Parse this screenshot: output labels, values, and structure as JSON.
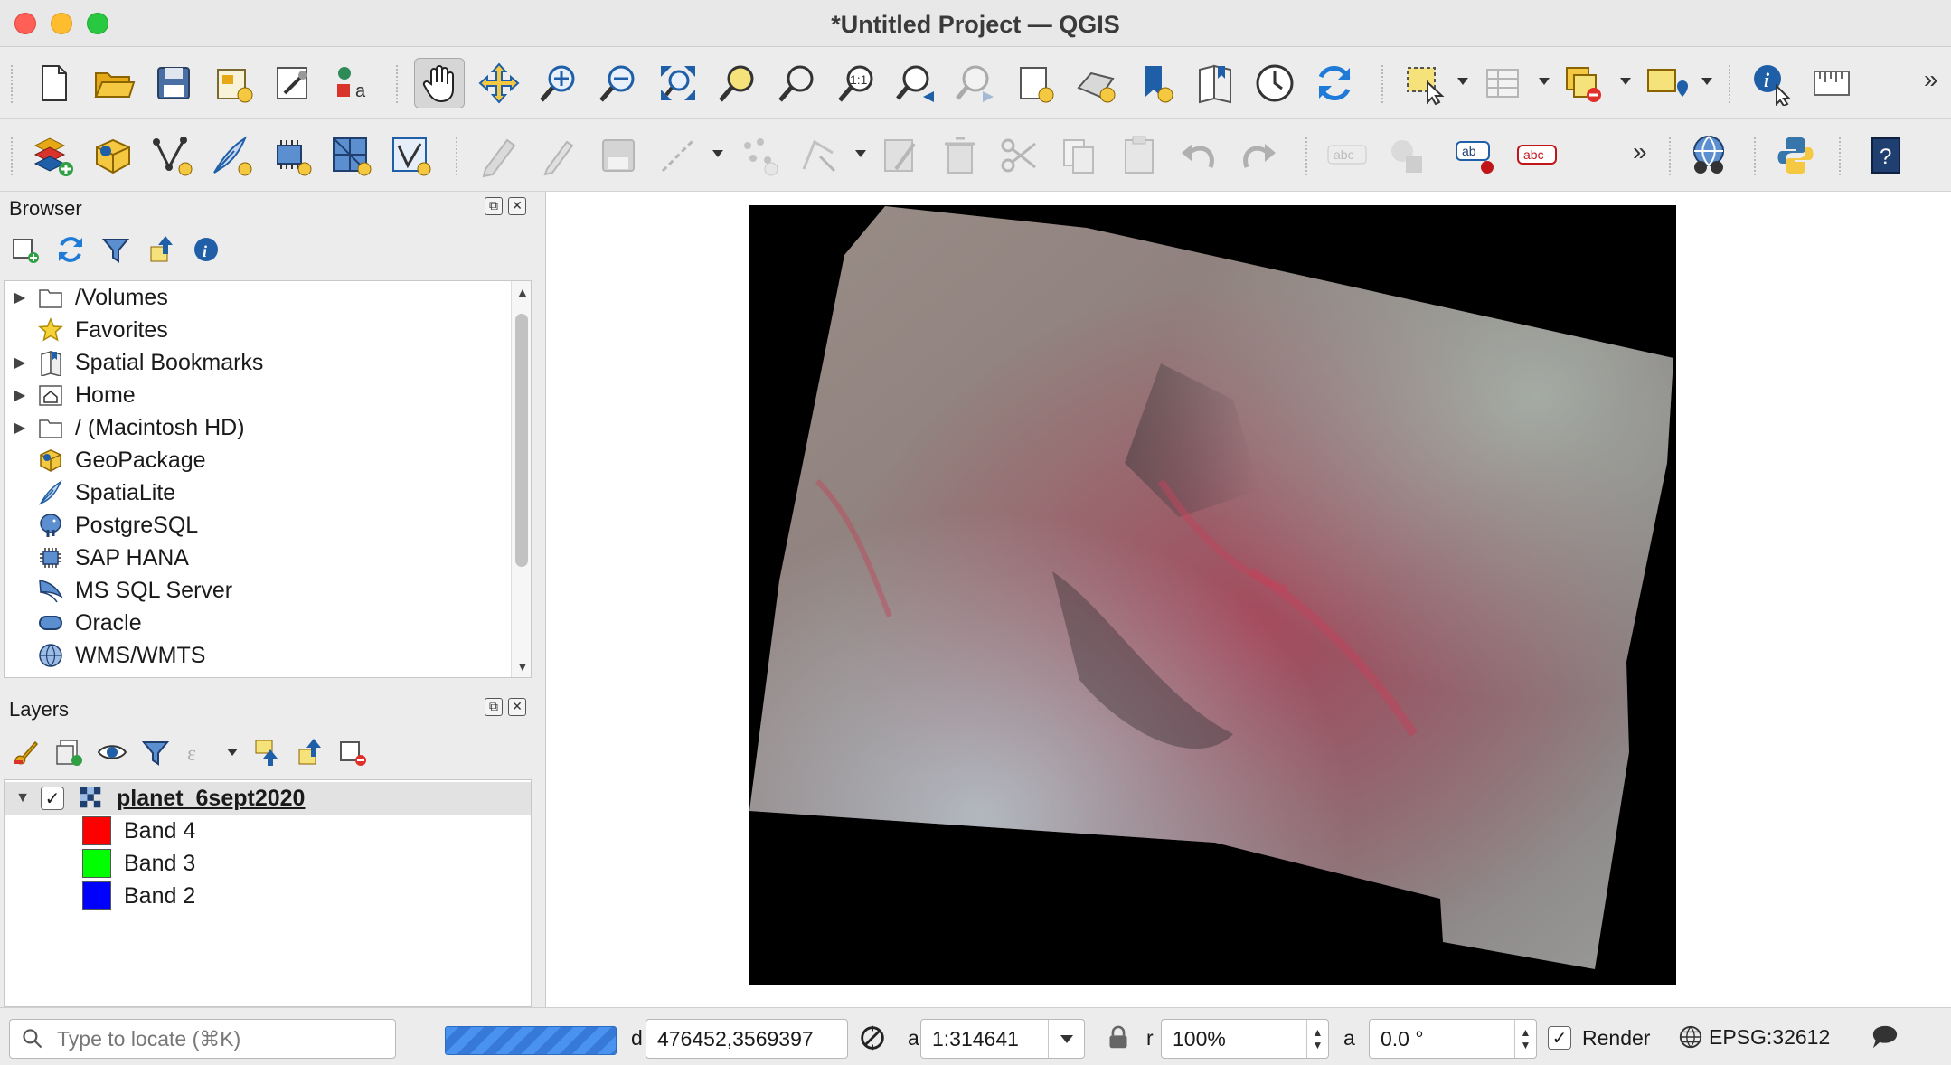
{
  "window": {
    "title": "*Untitled Project — QGIS"
  },
  "panels": {
    "browser": {
      "title": "Browser",
      "items": [
        {
          "label": "/Volumes",
          "icon": "folder-icon",
          "expandable": true
        },
        {
          "label": "Favorites",
          "icon": "star-icon",
          "expandable": false
        },
        {
          "label": "Spatial Bookmarks",
          "icon": "bookmark-icon",
          "expandable": true
        },
        {
          "label": "Home",
          "icon": "home-folder-icon",
          "expandable": true
        },
        {
          "label": "/ (Macintosh HD)",
          "icon": "folder-icon",
          "expandable": true
        },
        {
          "label": "GeoPackage",
          "icon": "geopackage-icon",
          "expandable": false
        },
        {
          "label": "SpatiaLite",
          "icon": "spatialite-feather-icon",
          "expandable": false
        },
        {
          "label": "PostgreSQL",
          "icon": "postgresql-elephant-icon",
          "expandable": false
        },
        {
          "label": "SAP HANA",
          "icon": "sap-hana-icon",
          "expandable": false
        },
        {
          "label": "MS SQL Server",
          "icon": "mssql-icon",
          "expandable": false
        },
        {
          "label": "Oracle",
          "icon": "oracle-icon",
          "expandable": false
        },
        {
          "label": "WMS/WMTS",
          "icon": "globe-icon",
          "expandable": false
        }
      ]
    },
    "layers": {
      "title": "Layers",
      "layer_name": "planet_6sept2020",
      "checked": true,
      "bands": [
        {
          "label": "Band 4",
          "color": "#ff0000"
        },
        {
          "label": "Band 3",
          "color": "#00ff00"
        },
        {
          "label": "Band 2",
          "color": "#0000ff"
        }
      ]
    }
  },
  "toolbar": {
    "overflow_glyph": "»"
  },
  "statusbar": {
    "locate_placeholder": "Type to locate (⌘K)",
    "coordinate_label": "d",
    "coordinate": "476452,3569397",
    "scale_label": "a",
    "scale": "1:314641",
    "magnifier_label": "r",
    "magnifier": "100%",
    "rotation_label": "a",
    "rotation": "0.0 °",
    "render_label": "Render",
    "render_checked": true,
    "crs": "EPSG:32612"
  }
}
